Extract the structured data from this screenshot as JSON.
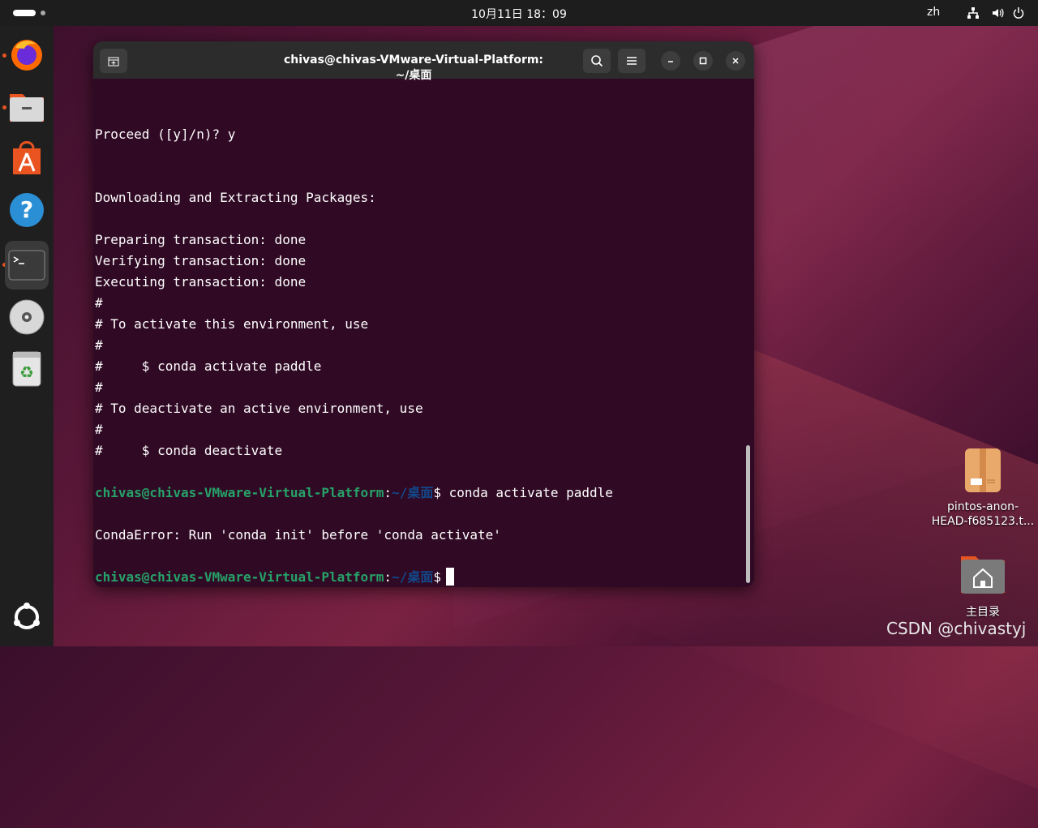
{
  "topbar": {
    "clock": "10月11日  18：09",
    "lang": "zh"
  },
  "dock": {
    "items": [
      {
        "name": "firefox-icon"
      },
      {
        "name": "files-icon"
      },
      {
        "name": "app-center-icon"
      },
      {
        "name": "help-icon"
      },
      {
        "name": "terminal-icon"
      },
      {
        "name": "disc-icon"
      },
      {
        "name": "trash-icon"
      },
      {
        "name": "show-apps-icon"
      }
    ]
  },
  "terminal": {
    "title": "chivas@chivas-VMware-Virtual-Platform: ~/桌面",
    "lines": [
      "Proceed ([y]/n)? y",
      "Downloading and Extracting Packages:",
      "Preparing transaction: done",
      "Verifying transaction: done",
      "Executing transaction: done",
      "#",
      "# To activate this environment, use",
      "#",
      "#     $ conda activate paddle",
      "#",
      "# To deactivate an active environment, use",
      "#",
      "#     $ conda deactivate",
      "CondaError: Run 'conda init' before 'conda activate'"
    ],
    "prompt_user": "chivas@chivas-VMware-Virtual-Platform",
    "prompt_colon": ":",
    "prompt_path": "~/桌面",
    "prompt_dollar": "$",
    "command_1": " conda activate paddle"
  },
  "desktop": {
    "file_label_line1": "pintos-anon-",
    "file_label_line2": "HEAD-f685123.t...",
    "home_label": "主目录"
  },
  "watermark": "CSDN @chivastyj",
  "colors": {
    "terminal_bg": "#300a24",
    "prompt_green": "#26a269",
    "prompt_blue": "#12488b",
    "accent": "#e95420"
  }
}
